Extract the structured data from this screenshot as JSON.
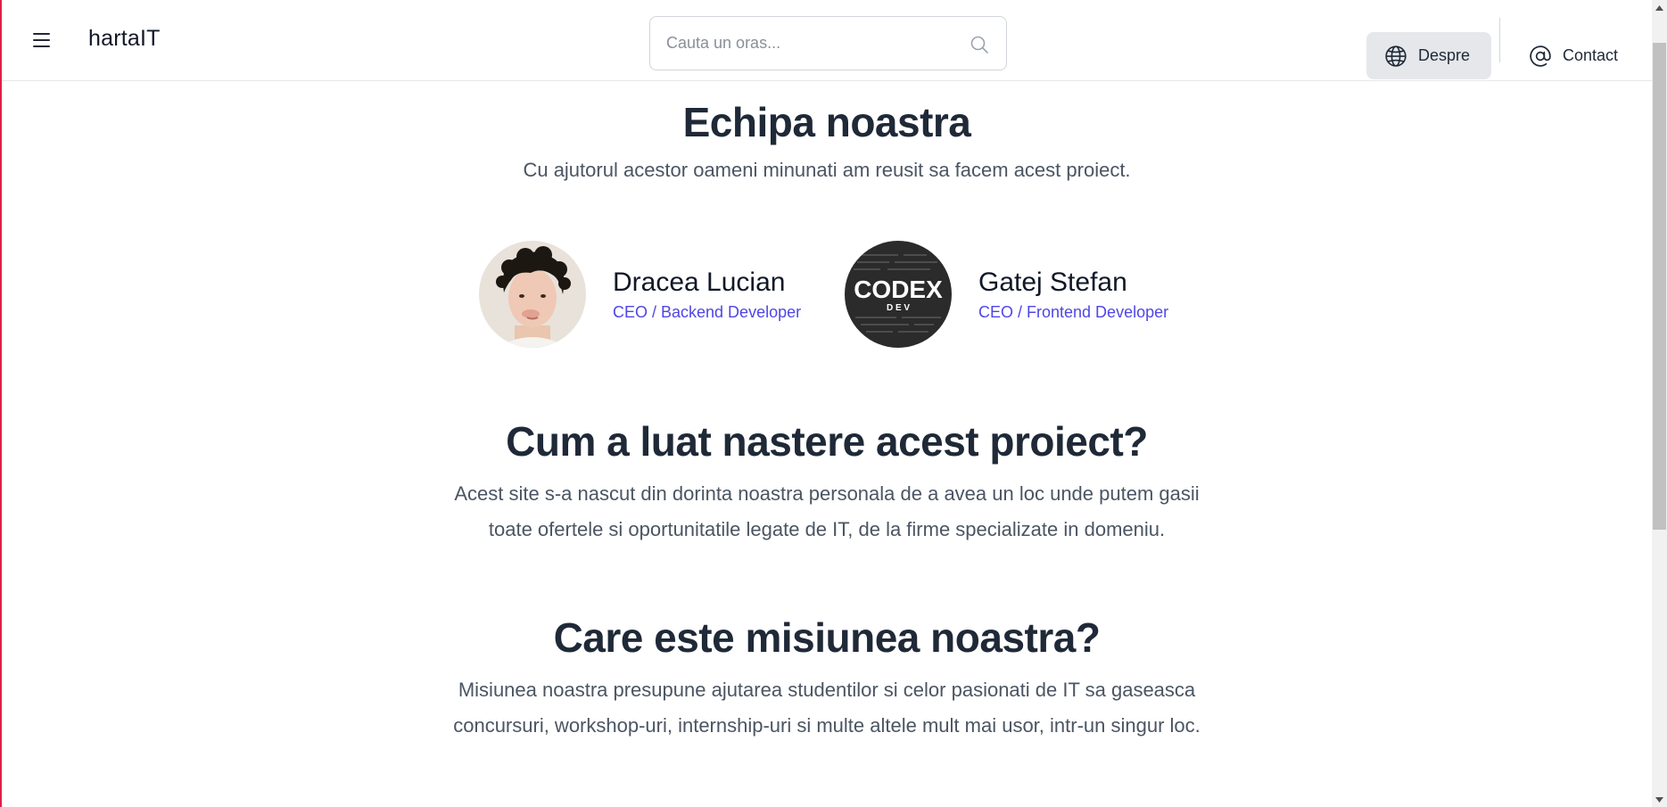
{
  "header": {
    "brand": "hartaIT",
    "search": {
      "placeholder": "Cauta un oras...",
      "value": ""
    },
    "nav": {
      "despre_label": "Despre",
      "contact_label": "Contact"
    }
  },
  "team": {
    "title": "Echipa noastra",
    "subtitle": "Cu ajutorul acestor oameni minunati am reusit sa facem acest proiect.",
    "members": [
      {
        "name": "Dracea Lucian",
        "role": "CEO / Backend Developer",
        "avatar_icon": "person-photo"
      },
      {
        "name": "Gatej Stefan",
        "role": "CEO / Frontend Developer",
        "avatar_icon": "codex-dev-logo",
        "avatar_text": "CODEX",
        "avatar_subtext": "D E V"
      }
    ]
  },
  "origin": {
    "title": "Cum a luat nastere acest proiect?",
    "line1": "Acest site s-a nascut din dorinta noastra personala de a avea un loc unde putem gasii",
    "line2": "toate ofertele si oportunitatile legate de IT, de la firme specializate in domeniu."
  },
  "mission": {
    "title": "Care este misiunea noastra?",
    "line1": "Misiunea noastra presupune ajutarea studentilor si celor pasionati de IT sa gaseasca",
    "line2": "concursuri, workshop-uri, internship-uri si multe altele mult mai usor, intr-un singur loc."
  },
  "colors": {
    "accent": "#4f46e5",
    "heading": "#1f2937",
    "body_text": "#4b5563",
    "nav_active_bg": "#e5e7eb"
  }
}
